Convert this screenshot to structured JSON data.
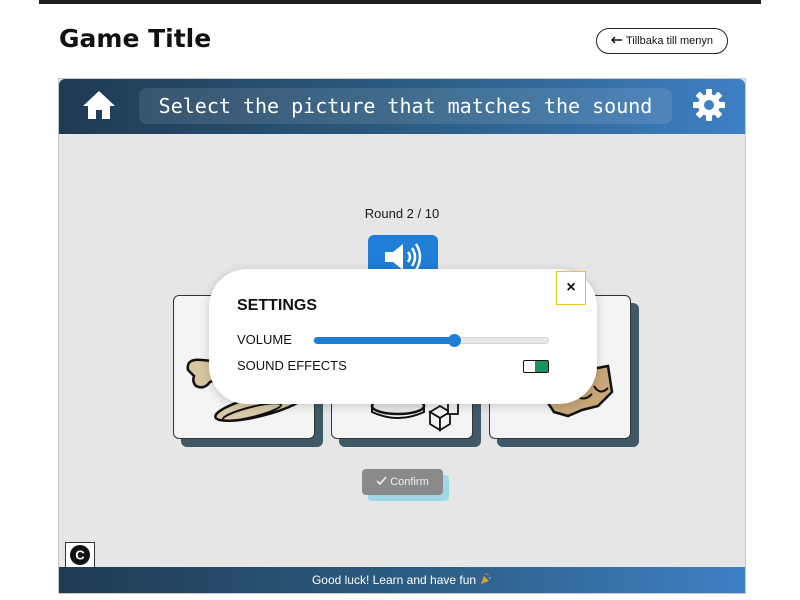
{
  "page": {
    "title": "Game Title",
    "back_button_label": "Tillbaka till menyn",
    "back_icon": "arrow-left-icon"
  },
  "game": {
    "instruction": "Select the picture that matches the sound",
    "home_icon": "home-icon",
    "settings_icon": "gear-icon",
    "round_label": "Round 2 / 10",
    "sound_icon": "speaker-icon",
    "cards": [
      {
        "name": "card-1",
        "icon": "bread-board-icon"
      },
      {
        "name": "card-2",
        "icon": "plate-dice-icon"
      },
      {
        "name": "card-3",
        "icon": "egg-carton-icon"
      }
    ],
    "confirm_label": "Confirm",
    "confirm_icon": "check-icon",
    "c_badge": "C",
    "footer_text": "Good luck! Learn and have fun",
    "footer_icon": "party-popper-icon"
  },
  "settings_modal": {
    "title": "SETTINGS",
    "volume_label": "VOLUME",
    "volume_level": 0.6,
    "sound_effects_label": "SOUND EFFECTS",
    "sound_effects_on": true,
    "close_label": "×"
  },
  "colors": {
    "header_dark": "#1f3a53",
    "header_light": "#3f7fc4",
    "accent_blue": "#1f7ed6",
    "toggle_green": "#179360",
    "card_shadow": "#3f5a66",
    "confirm_shadow": "#9fd8ea",
    "close_border": "#f0c419"
  }
}
